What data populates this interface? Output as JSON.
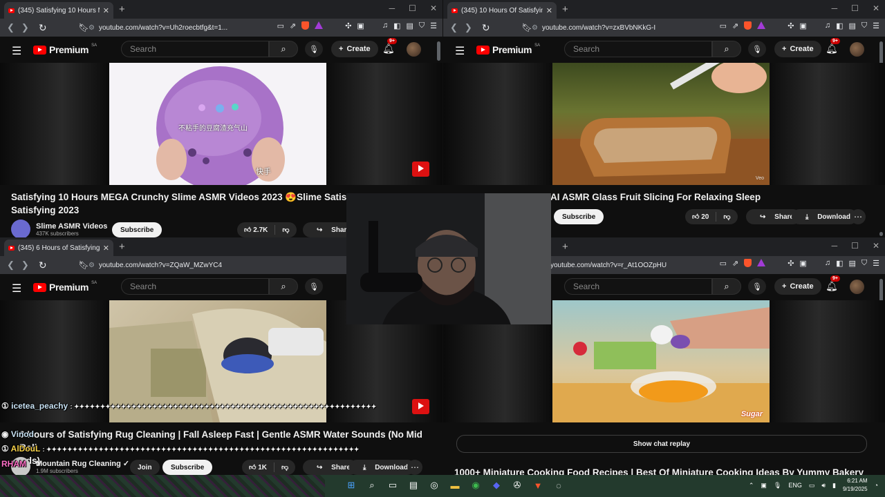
{
  "youtube": {
    "logo_word": "Premium",
    "country": "SA",
    "search_placeholder": "Search",
    "create_label": "Create",
    "notif_count": "9+"
  },
  "windows": [
    {
      "tab_title": "(345) Satisfying 10 Hours MEGA",
      "url": "youtube.com/watch?v=Uh2roecbtfg&t=1...",
      "video_title_line1": "Satisfying 10 Hours MEGA Crunchy Slime ASMR Videos 2023 😍Slime Satisfacto",
      "video_title_line2": "Satisfying 2023",
      "thumb_caption": "不粘手的豆腐渣充气山",
      "thumb_brand": "快手",
      "channel_name": "Slime ASMR Videos",
      "channel_subs": "437K subscribers",
      "subscribe": "Subscribe",
      "likes": "2.7K",
      "share": "Share"
    },
    {
      "tab_title": "(345) 10 Hours Of Satisfying AI",
      "url": "youtube.com/watch?v=zxBVbNKkG-I",
      "video_title": "AI ASMR Glass Fruit Slicing For Relaxing Sleep",
      "thumb_watermark": "Veo",
      "subscribe": "Subscribe",
      "likes": "20",
      "share": "Share",
      "download": "Download"
    },
    {
      "tab_title": "(345) 6 Hours of Satisfying Rug",
      "url": "youtube.com/watch?v=ZQaW_MZwYC4",
      "video_title_line1": "6 Hours of Satisfying Rug Cleaning | Fall Asleep Fast | Gentle ASMR Water Sounds (No Mid Roll",
      "video_title_line2": "Ads)",
      "channel_name": "Mountain Rug Cleaning",
      "channel_subs": "1.9M subscribers",
      "join": "Join",
      "subscribe": "Subscribe",
      "likes": "1K",
      "share": "Share",
      "download": "Download"
    },
    {
      "url": "youtube.com/watch?v=r_At1OOZpHU",
      "show_chat_replay": "Show chat replay",
      "video_title": "1000+ Miniature Cooking Food Recipes | Best Of Miniature Cooking Ideas By Yummy Bakery",
      "thumb_watermark": "Sugar"
    }
  ],
  "chat_overlay": [
    {
      "user": "icetea_peachy",
      "message": ": ✦✦✦✦✦✦✦✦✦✦✦✦✦✦✦✦✦✦✦✦✦✦✦✦✦✦✦✦✦✦✦✦✦✦✦✦✦✦✦✦✦✦✦✦✦✦✦✦✦✦✦✦✦✦✦✦✦✦"
    },
    {
      "user": "Vinod",
      "message": ""
    },
    {
      "user": "AlDouL",
      "message": ": ✦✦✦✦✦✦✦✦✦✦✦✦✦✦✦✦✦✦✦✦✦✦✦✦✦✦✦✦✦✦✦✦✦✦✦✦✦✦✦✦✦✦✦✦✦✦✦✦✦✦✦✦✦✦✦✦✦✦✦✦"
    },
    {
      "user": "RHAM",
      "message": ""
    }
  ],
  "taskbar": {
    "lang": "ENG",
    "time": "6:21 AM",
    "date": "9/19/2025"
  },
  "colors": {
    "yt_red": "#ff0000",
    "page_bg": "#0f0f0f",
    "chrome_bg": "#202124",
    "toolbar_bg": "#35363a"
  }
}
